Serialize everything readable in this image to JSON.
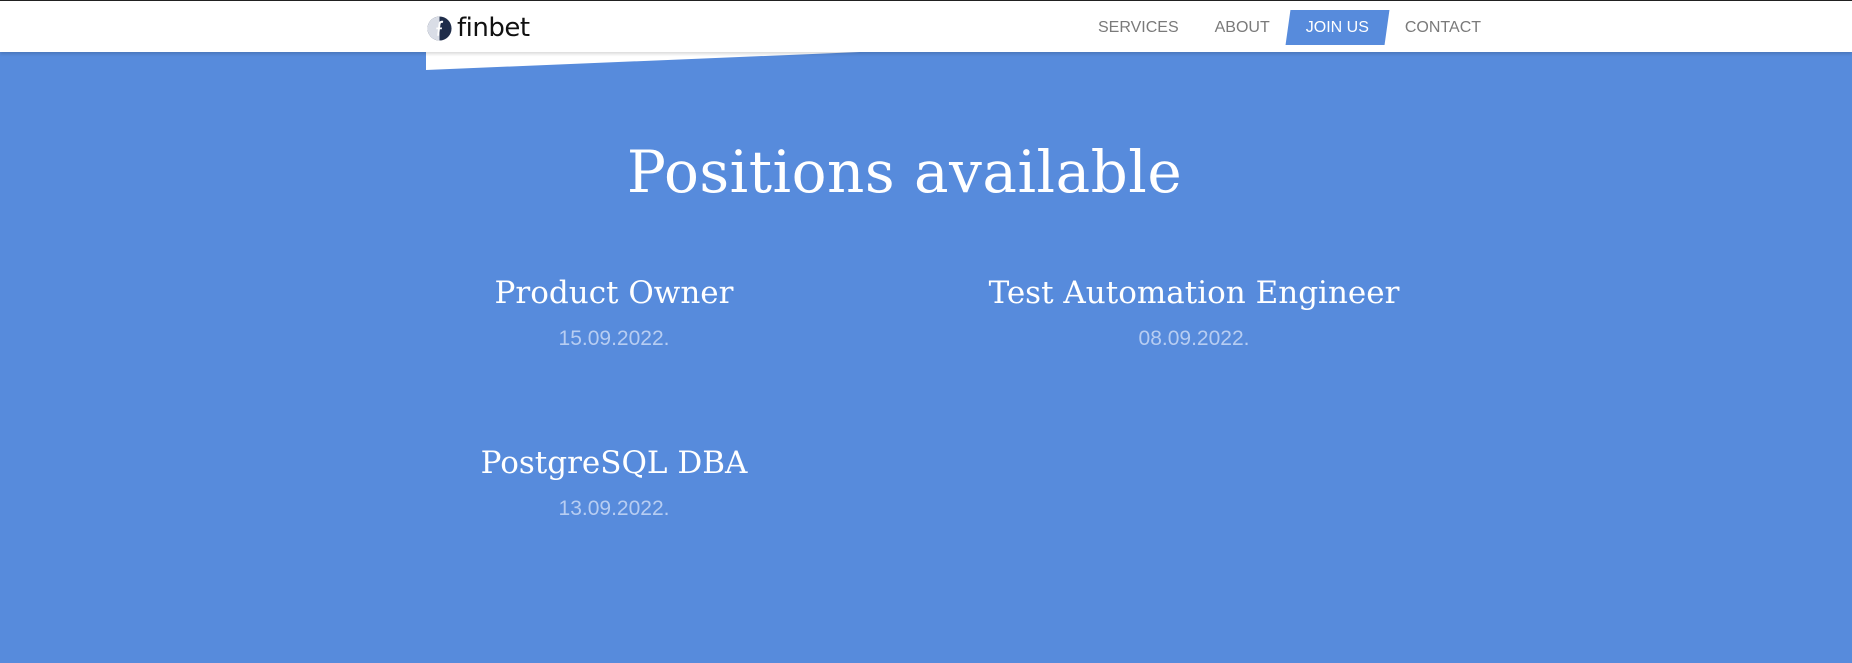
{
  "brand": {
    "name": "finbet",
    "logo_icon": "finbet-logo-icon"
  },
  "nav": {
    "items": [
      {
        "label": "SERVICES",
        "active": false
      },
      {
        "label": "ABOUT",
        "active": false
      },
      {
        "label": "JOIN US",
        "active": true
      },
      {
        "label": "CONTACT",
        "active": false
      }
    ]
  },
  "main": {
    "title": "Positions available",
    "positions": [
      {
        "title": "Product Owner",
        "date": "15.09.2022."
      },
      {
        "title": "Test Automation Engineer",
        "date": "08.09.2022."
      },
      {
        "title": "PostgreSQL DBA",
        "date": "13.09.2022."
      }
    ]
  },
  "colors": {
    "accent": "#578bdc",
    "header_bg": "#ffffff",
    "nav_text": "#7a7a7a",
    "date_text": "#b7cdf2"
  }
}
